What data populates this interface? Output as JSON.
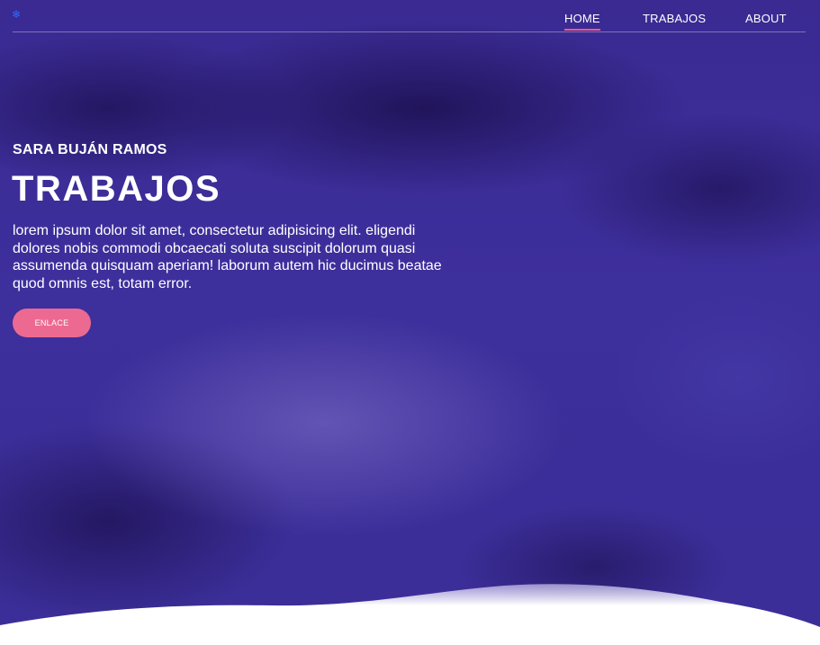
{
  "nav": {
    "brand_icon": "snowflake-icon",
    "items": [
      {
        "label": "HOME",
        "active": true
      },
      {
        "label": "TRABAJOS",
        "active": false
      },
      {
        "label": "ABOUT",
        "active": false
      }
    ]
  },
  "hero": {
    "author": "SARA BUJÁN RAMOS",
    "title": "TRABAJOS",
    "body": "lorem ipsum dolor sit amet, consectetur adipisicing elit. eligendi dolores nobis commodi obcaecati soluta suscipit dolorum quasi assumenda quisquam aperiam! laborum autem hic ducimus beatae quod omnis est, totam error.",
    "cta_label": "ENLACE"
  },
  "colors": {
    "overlay": "#3a2a92",
    "accent": "#ec6a92",
    "text": "#ffffff"
  }
}
